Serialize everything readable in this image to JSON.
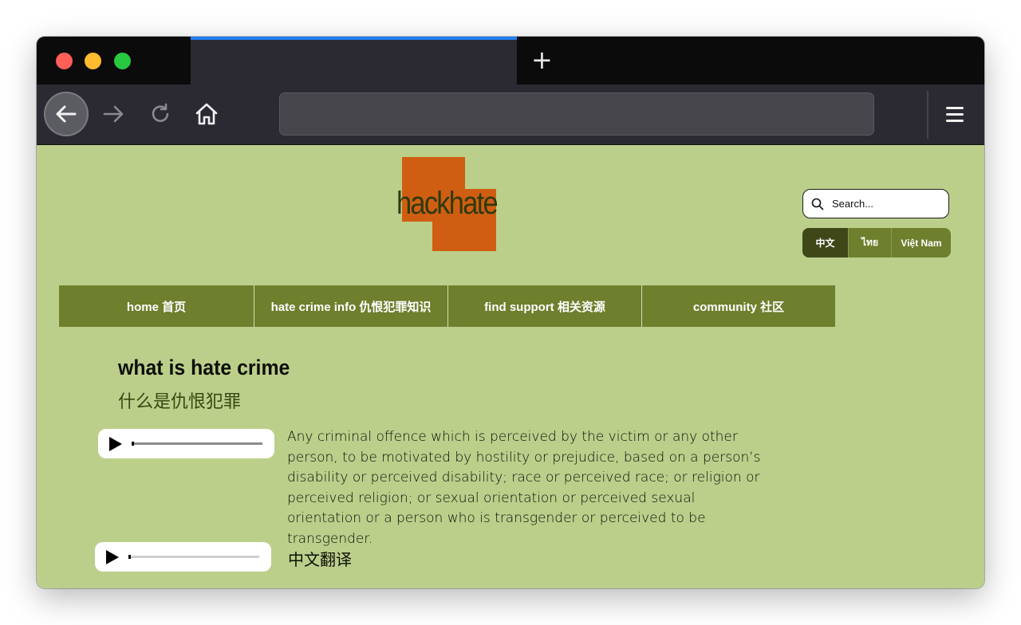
{
  "browser": {
    "new_tab_glyph": "+",
    "url": "",
    "icons": [
      "back-arrow-icon",
      "forward-arrow-icon",
      "reload-icon",
      "home-icon",
      "hamburger-menu-icon"
    ]
  },
  "site": {
    "logo_text": "hackhate",
    "search": {
      "placeholder": "Search..."
    },
    "languages": [
      {
        "label": "中文",
        "active": true
      },
      {
        "label": "ไทย",
        "active": false
      },
      {
        "label": "Việt Nam",
        "active": false
      }
    ],
    "nav": [
      {
        "label": "home 首页"
      },
      {
        "label": "hate crime info 仇恨犯罪知识"
      },
      {
        "label": "find support 相关资源"
      },
      {
        "label": "community 社区"
      }
    ]
  },
  "article": {
    "heading_en": "what is hate crime",
    "heading_zh": "什么是仇恨犯罪",
    "definition": "Any criminal offence which is perceived by the victim or any other person, to be motivated by hostility or prejudice, based on a person’s disability or perceived disability; race or perceived race; or religion or perceived religion; or sexual orientation or perceived sexual orientation or a person who is transgender or perceived to be transgender.",
    "translation_label": "中文翻译"
  },
  "colors": {
    "page_bg": "#bbcf8b",
    "nav_bg": "#6e7f2d",
    "logo_orange": "#d05e12",
    "lang_active": "#3f4719"
  }
}
